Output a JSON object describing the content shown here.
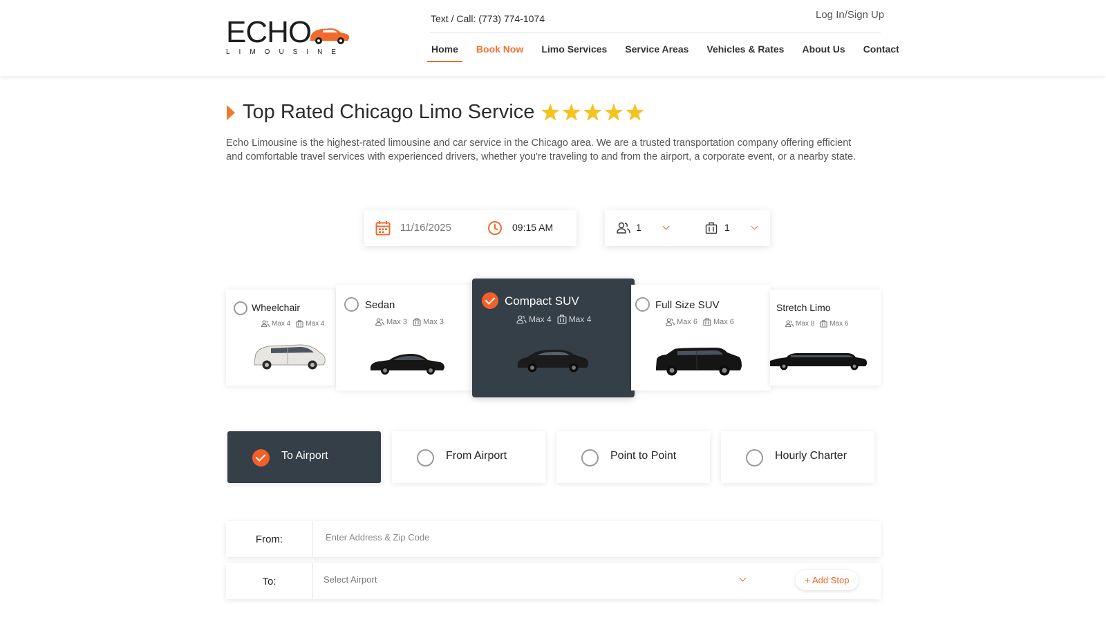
{
  "brand": {
    "name": "ECHO",
    "tagline": "LIMOUSINE",
    "accent": "#f16a2c",
    "dark": "#353f47"
  },
  "header": {
    "phone": "Text / Call: (773) 774-1074",
    "login": "Log In/Sign Up",
    "nav": [
      {
        "label": "Home",
        "active": true
      },
      {
        "label": "Book Now",
        "highlight": true
      },
      {
        "label": "Limo Services"
      },
      {
        "label": "Service Areas"
      },
      {
        "label": "Vehicles & Rates"
      },
      {
        "label": "About Us"
      },
      {
        "label": "Contact"
      }
    ]
  },
  "hero": {
    "title": "Top Rated Chicago Limo Service",
    "rating": 5,
    "description": "Echo Limousine is the highest-rated limousine and car service in the Chicago area. We are a trusted transportation company offering efficient and comfortable travel services with experienced drivers, whether you're traveling to and from the airport, a corporate event, or a nearby state."
  },
  "booking": {
    "date": "11/16/2025",
    "time": "09:15 AM",
    "passengers": "1",
    "luggage": "1"
  },
  "vehicles": [
    {
      "name": "Wheelchair",
      "passengers": "Max 4",
      "luggage": "Max 4",
      "selected": false
    },
    {
      "name": "Sedan",
      "passengers": "Max 3",
      "luggage": "Max 3",
      "selected": false
    },
    {
      "name": "Compact SUV",
      "passengers": "Max 4",
      "luggage": "Max 4",
      "selected": true
    },
    {
      "name": "Full Size SUV",
      "passengers": "Max 6",
      "luggage": "Max 6",
      "selected": false
    },
    {
      "name": "Stretch Limo",
      "passengers": "Max 8",
      "luggage": "Max 6",
      "selected": false
    }
  ],
  "trip_types": [
    {
      "label": "To Airport",
      "selected": true
    },
    {
      "label": "From Airport",
      "selected": false
    },
    {
      "label": "Point to Point",
      "selected": false
    },
    {
      "label": "Hourly Charter",
      "selected": false
    }
  ],
  "address": {
    "from_label": "From:",
    "from_placeholder": "Enter Address & Zip Code",
    "to_label": "To:",
    "to_value": "Select Airport",
    "add_stop": "+ Add Stop"
  }
}
